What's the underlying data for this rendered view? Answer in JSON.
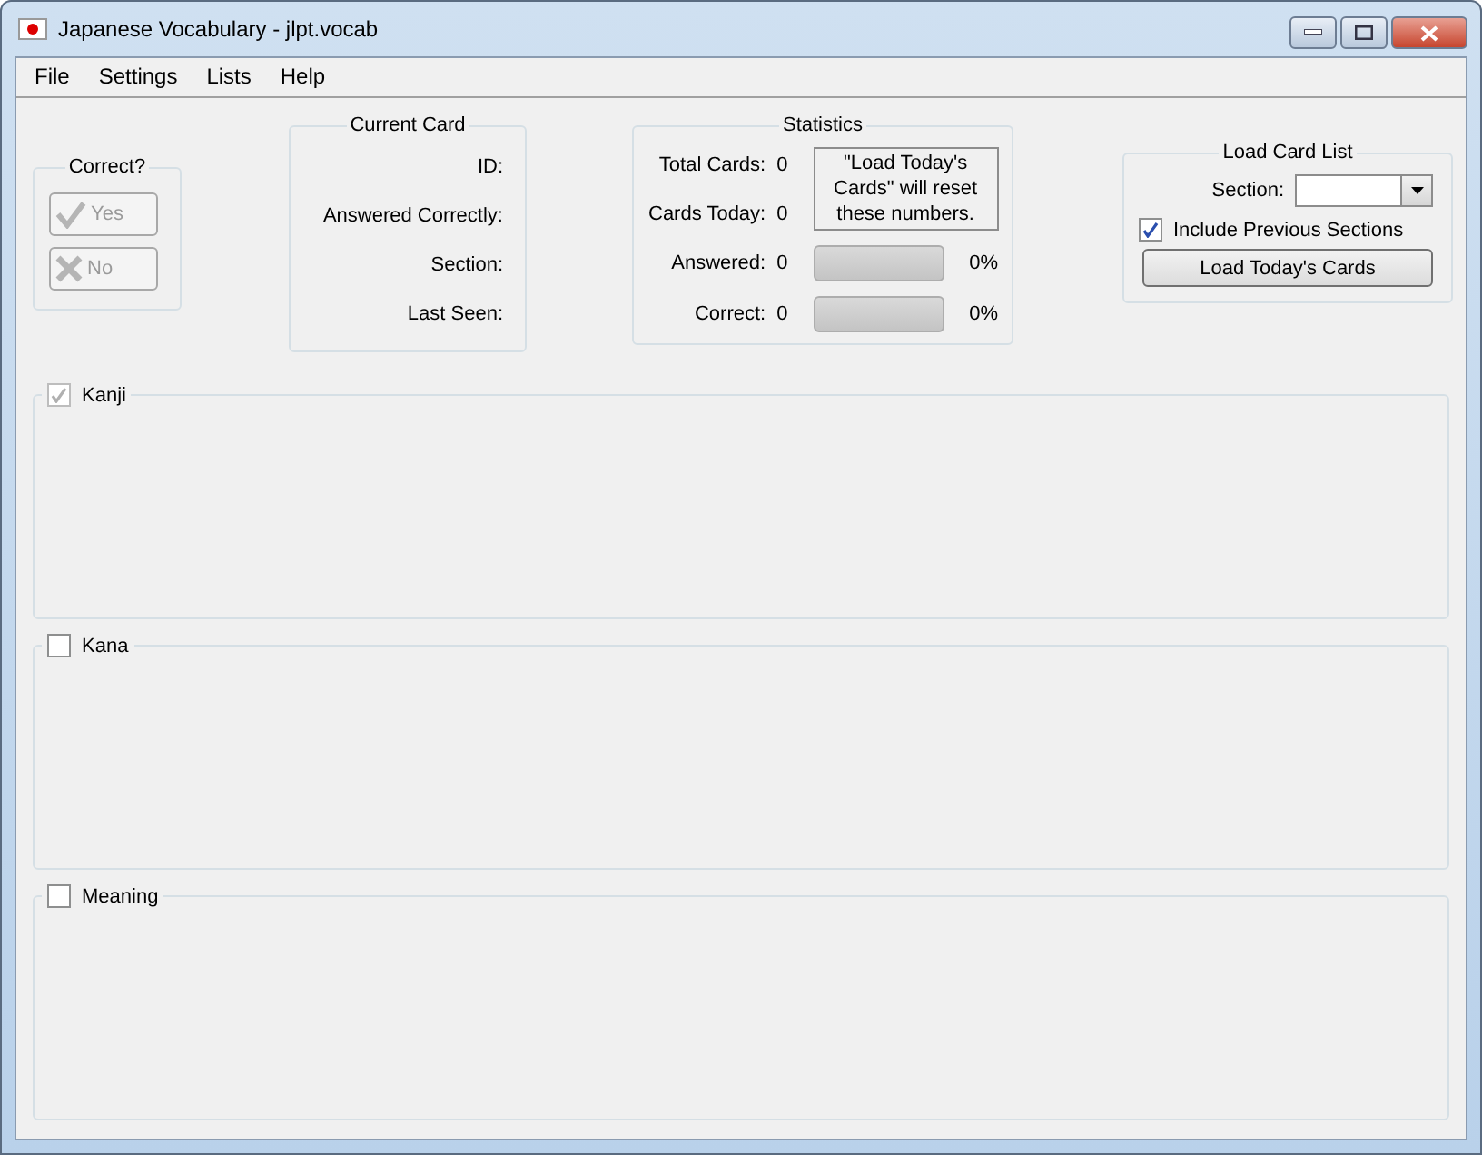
{
  "window": {
    "title": "Japanese Vocabulary - jlpt.vocab"
  },
  "menu": [
    "File",
    "Settings",
    "Lists",
    "Help"
  ],
  "correct_group": {
    "title": "Correct?",
    "buttons": [
      {
        "kind": "yes",
        "label": "Yes",
        "disabled": true
      },
      {
        "kind": "no",
        "label": "No",
        "disabled": true
      }
    ]
  },
  "current_card": {
    "title": "Current Card",
    "fields": [
      "ID:",
      "Answered Correctly:",
      "Section:",
      "Last Seen:"
    ]
  },
  "statistics": {
    "title": "Statistics",
    "counts": [
      {
        "label": "Total Cards:",
        "value": "0"
      },
      {
        "label": "Cards Today:",
        "value": "0"
      }
    ],
    "note": "\"Load Today's Cards\" will reset these numbers.",
    "meters": [
      {
        "label": "Answered:",
        "value": "0",
        "level": 0,
        "reading": "0%"
      },
      {
        "label": "Correct:",
        "value": "0",
        "level": 0,
        "reading": "0%"
      }
    ]
  },
  "load_card_list": {
    "title": "Load Card List",
    "section_label": "Section:",
    "include_previous": {
      "label": "Include Previous Sections",
      "checked": true
    },
    "button": "Load Today's Cards"
  },
  "panels": [
    {
      "label": "Kanji",
      "checked": true,
      "disabled": true
    },
    {
      "label": "Kana",
      "checked": false,
      "disabled": false
    },
    {
      "label": "Meaning",
      "checked": false,
      "disabled": false
    }
  ]
}
